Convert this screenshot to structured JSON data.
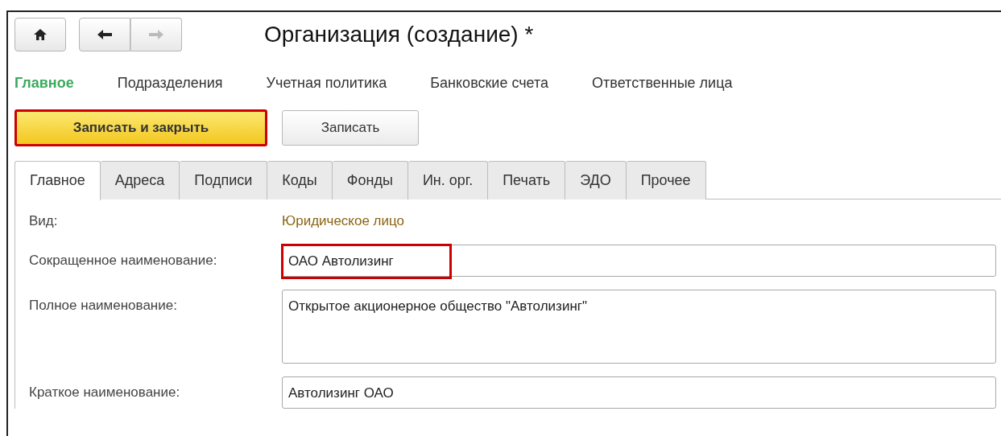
{
  "window": {
    "title": "Организация (создание) *"
  },
  "nav": {
    "back_enabled": true,
    "forward_enabled": false
  },
  "sections": [
    {
      "label": "Главное",
      "selected": true
    },
    {
      "label": "Подразделения",
      "selected": false
    },
    {
      "label": "Учетная политика",
      "selected": false
    },
    {
      "label": "Банковские счета",
      "selected": false
    },
    {
      "label": "Ответственные лица",
      "selected": false
    }
  ],
  "buttons": [
    {
      "label": "Записать и закрыть",
      "kind": "primary",
      "highlighted": true
    },
    {
      "label": "Записать",
      "kind": "default",
      "highlighted": false
    }
  ],
  "tabs": [
    {
      "label": "Главное",
      "selected": true
    },
    {
      "label": "Адреса",
      "selected": false
    },
    {
      "label": "Подписи",
      "selected": false
    },
    {
      "label": "Коды",
      "selected": false
    },
    {
      "label": "Фонды",
      "selected": false
    },
    {
      "label": "Ин. орг.",
      "selected": false
    },
    {
      "label": "Печать",
      "selected": false
    },
    {
      "label": "ЭДО",
      "selected": false
    },
    {
      "label": "Прочее",
      "selected": false
    }
  ],
  "fields": [
    {
      "kind": "link",
      "label": "Вид:",
      "value": "Юридическое лицо"
    },
    {
      "kind": "input",
      "label": "Сокращенное наименование:",
      "value": "ОАО Автолизинг",
      "highlighted": true
    },
    {
      "kind": "textarea",
      "label": "Полное наименование:",
      "value": "Открытое акционерное общество \"Автолизинг\"",
      "highlighted": false
    },
    {
      "kind": "input",
      "label": "Краткое наименование:",
      "value": "Автолизинг ОАО",
      "highlighted": false
    }
  ]
}
